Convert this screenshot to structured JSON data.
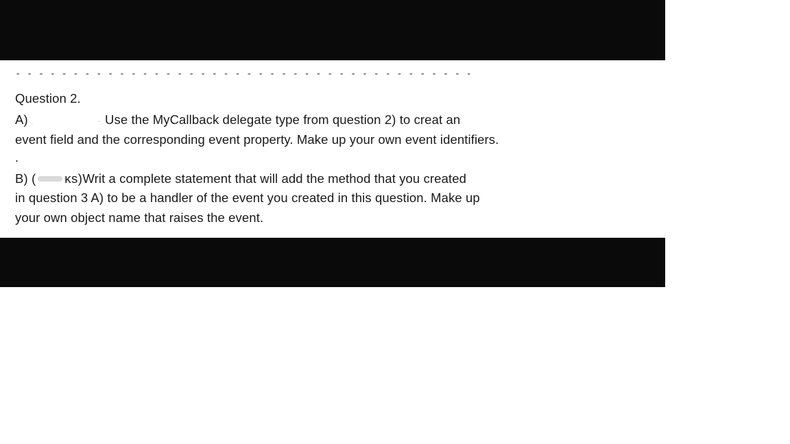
{
  "dashes": "- - - - - - - - - - - - - - - - - - - - - - - - - - - - - - - - - - - - - - - -",
  "question": {
    "heading": "Question 2.",
    "partA": {
      "prefix": "A)",
      "scribble_a": "ˎ",
      "scribble_b": "˗ˏ",
      "line1_rest": " Use the MyCallback delegate type from question 2) to creat an",
      "line2": "event field and the corresponding event property. Make up your own event identifiers."
    },
    "dot": ".",
    "partB": {
      "prefix": "B) (",
      "ks": "ᴋs)",
      "line1_rest": " Writ a complete statement that will add the method that you created",
      "line2": "in question 3 A) to be a handler of the event you created in this question. Make up",
      "line3": "your own object name that raises the event."
    }
  }
}
